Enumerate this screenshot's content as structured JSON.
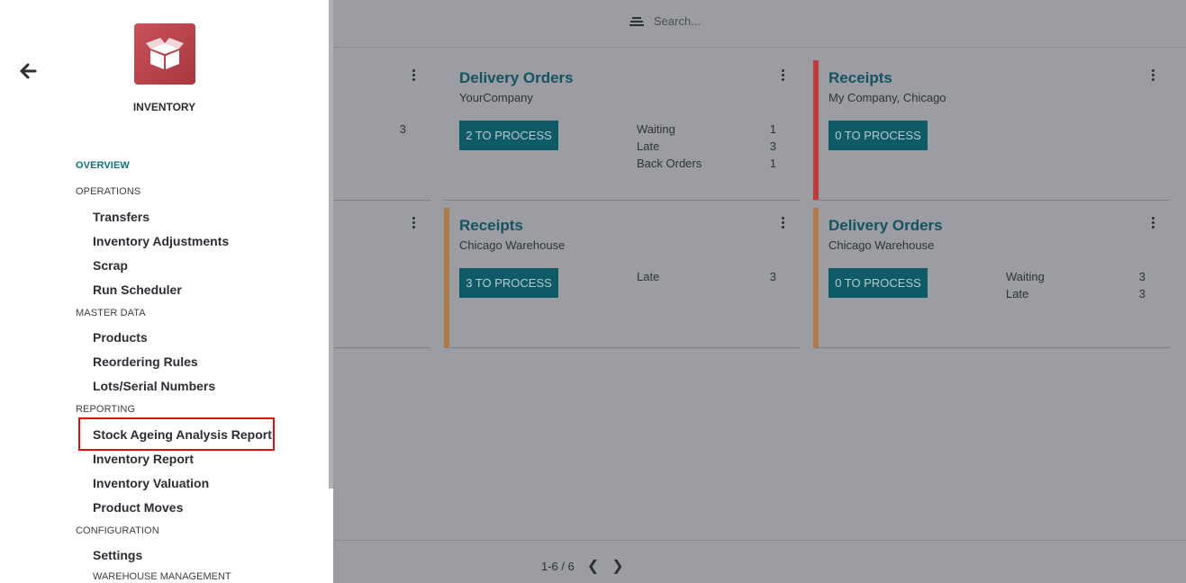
{
  "search": {
    "placeholder": "Search..."
  },
  "pager": {
    "range": "1-6 / 6"
  },
  "cards": [
    {
      "title": "",
      "subtitle": "",
      "button": "",
      "stats": [
        {
          "label": "",
          "value": "3"
        }
      ]
    },
    {
      "title": "Delivery Orders",
      "subtitle": "YourCompany",
      "button": "2 TO PROCESS",
      "stats": [
        {
          "label": "Waiting",
          "value": "1"
        },
        {
          "label": "Late",
          "value": "3"
        },
        {
          "label": "Back Orders",
          "value": "1"
        }
      ]
    },
    {
      "title": "Receipts",
      "subtitle": "My Company, Chicago",
      "button": "0 TO PROCESS",
      "stats": [],
      "accent": "#c0393f"
    },
    {
      "title": "",
      "subtitle": "",
      "button": "",
      "stats": []
    },
    {
      "title": "Receipts",
      "subtitle": "Chicago Warehouse",
      "button": "3 TO PROCESS",
      "stats": [
        {
          "label": "Late",
          "value": "3"
        }
      ],
      "accent": "#b07a4a"
    },
    {
      "title": "Delivery Orders",
      "subtitle": "Chicago Warehouse",
      "button": "0 TO PROCESS",
      "stats": [
        {
          "label": "Waiting",
          "value": "3"
        },
        {
          "label": "Late",
          "value": "3"
        }
      ],
      "accent": "#b07a4a"
    }
  ],
  "sidebar": {
    "app_name": "INVENTORY",
    "back_icon": "arrow-left-icon",
    "logo_icon": "open-box-icon",
    "sections": {
      "overview": "OVERVIEW",
      "operations": "OPERATIONS",
      "master_data": "MASTER DATA",
      "reporting": "REPORTING",
      "configuration": "CONFIGURATION"
    },
    "items": {
      "transfers": "Transfers",
      "inventory_adjustments": "Inventory Adjustments",
      "scrap": "Scrap",
      "run_scheduler": "Run Scheduler",
      "products": "Products",
      "reordering_rules": "Reordering Rules",
      "lots_serial": "Lots/Serial Numbers",
      "stock_ageing": "Stock Ageing Analysis Report",
      "inventory_report": "Inventory Report",
      "inventory_valuation": "Inventory Valuation",
      "product_moves": "Product Moves",
      "settings": "Settings",
      "warehouse_management": "WAREHOUSE MANAGEMENT"
    }
  }
}
